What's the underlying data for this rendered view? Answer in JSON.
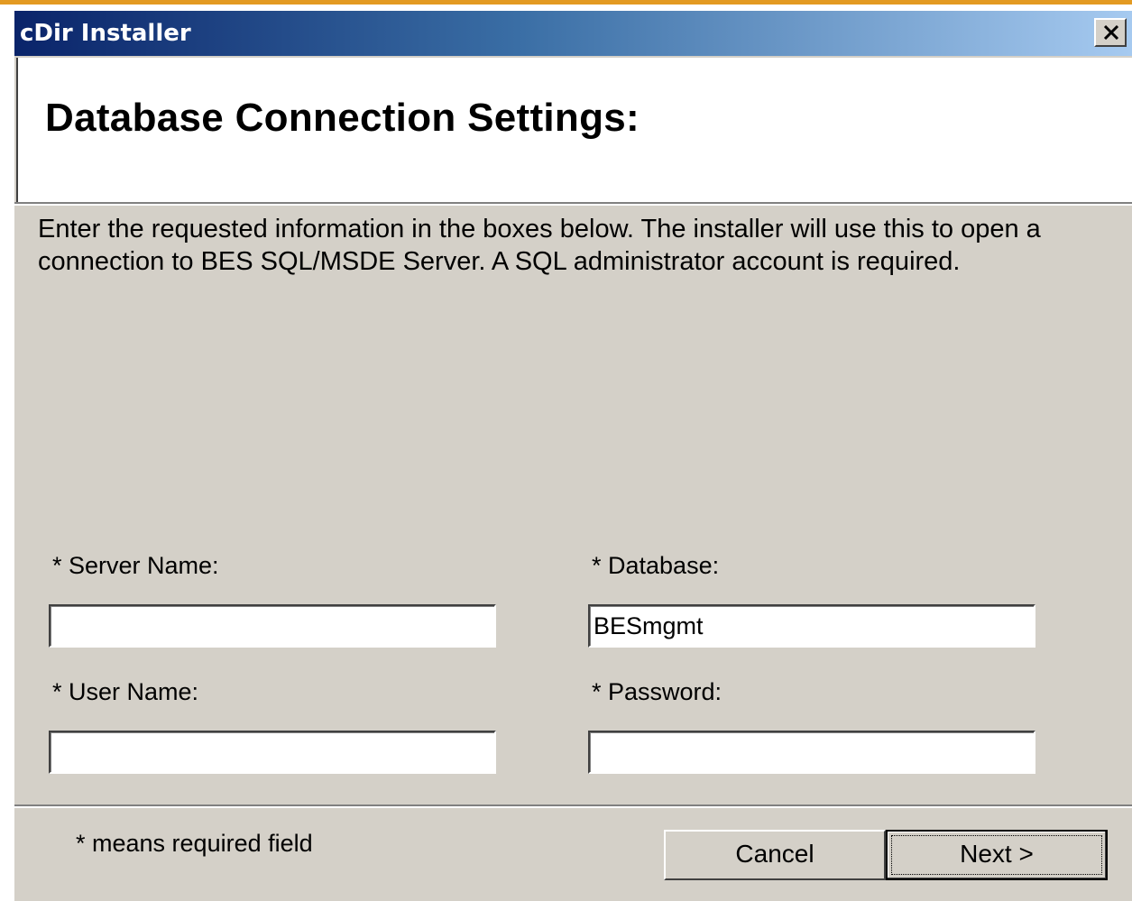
{
  "window": {
    "title": "cDir Installer",
    "close_icon": "close-x-icon"
  },
  "header": {
    "title": "Database Connection Settings:"
  },
  "instructions": "Enter the requested information in the boxes below. The installer will use this to open a connection to BES SQL/MSDE Server.  A SQL administrator account is required.",
  "fields": {
    "server_name": {
      "label": "* Server Name:",
      "value": ""
    },
    "database": {
      "label": "* Database:",
      "value": "BESmgmt"
    },
    "user_name": {
      "label": "* User Name:",
      "value": ""
    },
    "password": {
      "label": "* Password:",
      "value": ""
    }
  },
  "footer": {
    "required_note": "* means required field",
    "cancel_label": "Cancel",
    "next_label": "Next >"
  },
  "colors": {
    "title_gradient_start": "#0a246a",
    "title_gradient_end": "#a6caf0",
    "dialog_face": "#d4d0c8",
    "accent_line": "#e39a22"
  }
}
